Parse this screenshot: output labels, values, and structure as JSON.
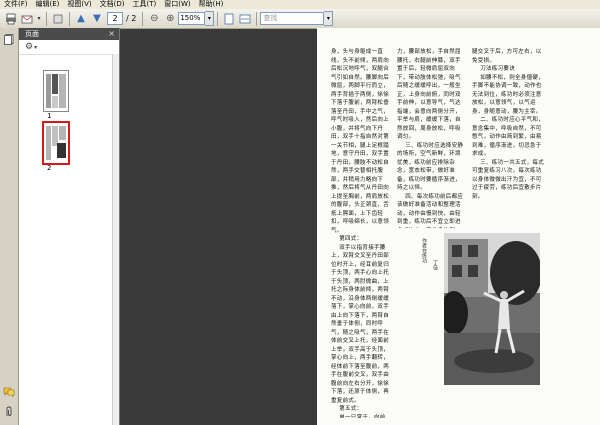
{
  "menu": [
    "文件(F)",
    "编辑(E)",
    "视图(V)",
    "文档(D)",
    "工具(T)",
    "窗口(W)",
    "帮助(H)"
  ],
  "toolbar": {
    "page_current": "2",
    "page_total": "/ 2",
    "zoom": "150%",
    "search_placeholder": "查找"
  },
  "panel": {
    "title": "页面",
    "thumbs": [
      {
        "label": "1"
      },
      {
        "label": "2"
      }
    ]
  },
  "document": {
    "col1": "身，头与身躯成一直线，头不前倾，两肩向后松沉地呼气，双腿合气引如自然。腰脚向后微屈，两脚平行而立，两手背插于两侧，徐徐下落于腹前，两臂松垂落至丹田，手中之气，呼气时吸入，然后向上小腹，并将气向下丹田，双手十指自然对第一关节相，腿上足根踏地，意守丹田，双手置于丹田，腰肢不动松自然，两手交替相托腹部，并稍用力略向下推，然后将气从丹田向上提至胸前，两肩放松的腹部，头正颈直，舌抵上腭面，上下齿轻扣，呼吸绵长，以意领气。\n    第四式：\n    双手以指背接手腰上，双臂交叉至丹田部位时开上，经耳前复归于头顶，两手心向上托于头顶，两肘微曲，上托之际身体前倾，两臂不动，沿身体两侧缓缓落下，掌心向前，双手由上向下落下，两臂自然垂于体侧，同时呼气，随之吸气，两手在体前交叉上托，经面前上举，双手高于头顶，掌心向上，两手翻转，经体前下落至腹前，两手在腹前交叉，双手由腹前向左右分开，徐徐下落，还原于体侧，再重复前式。\n    第五式：\n    单一只掌于，向前推出，人立于原地，左手掌缓缓向前推出，右手置于腰间，然后换右手，继续推掌，呼吸自然配合动作，意守丹田，身体中正，左右交替各做数次，推掌时呼气，收掌时吸气，动作缓慢均匀，连贯协调，周身放松，神态安详，目视前方，意念随掌而动。",
    "col2": "力，腰部放松，手自然屈腰托，右腿前伸膝，双手置于后，轻微肩屈双向下，带动肢体松弛，吸气后随之缓缓呼出，一般坐正，上身向前俯，同时双手前伸，以意导气，气达指端，会意向两侧分开，平举与肩，缓缓下落，自然放回，周身放松，呼吸调匀。\n    三、练功时应选择安静的场所，空气新鲜，环境优美，练功前应排除杂念，宽衣松带，做好准备，练功时要循序渐进，持之以恒。\n    四、每次练功前后都应该做好准备活动和整理活动，动作由慢到快，由轻到重，练功后不宜立即进食或饮水，应休息片刻。",
    "col3": "腿交叉于后，方可左右，以免受损。\n    刀法练习要诀\n    如腰不松，则全身僵硬，手脚不能协调一致，动作也无法到位，练功时必须注意放松，以意领气，以气运身，身随意动，腰为主宰。\n    二、练功时应心平气和，意念集中，呼吸自然，不可憋气，动作由简到繁，由易到难，循序渐进，切忌急于求成。\n    三、练功一共五式，每式可重复练习八次，每次练功以身体微微出汗为宜，不可过于疲劳，练功后宜散步片刻。",
    "photo_caption_left": "作者在练功",
    "photo_caption_right": "丁佳"
  }
}
